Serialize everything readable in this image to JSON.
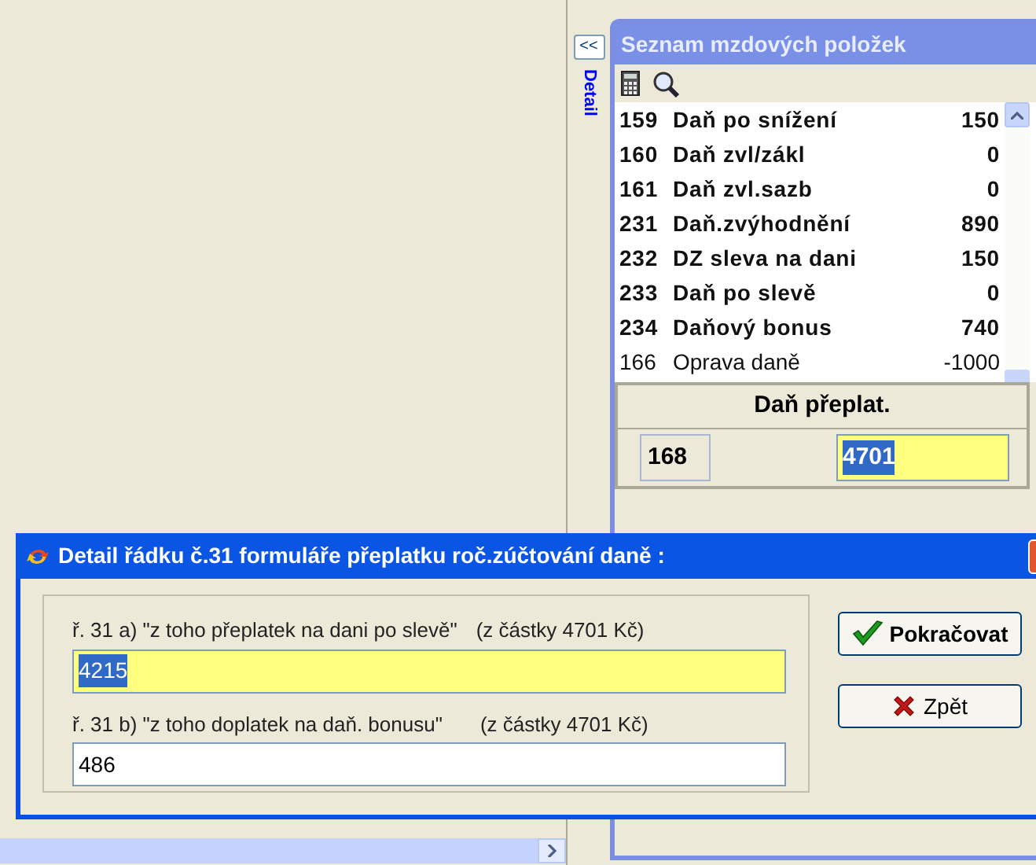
{
  "side_strip": {
    "collapse_button": "<<",
    "tab_label": "Detail"
  },
  "panel": {
    "title": "Seznam mzdových položek",
    "items": [
      {
        "code": "159",
        "name": "Daň po snížení",
        "value": "150",
        "emphasized": true
      },
      {
        "code": "160",
        "name": "Daň zvl/zákl",
        "value": "0",
        "emphasized": true
      },
      {
        "code": "161",
        "name": "Daň zvl.sazb",
        "value": "0",
        "emphasized": true
      },
      {
        "code": "231",
        "name": "Daň.zvýhodnění",
        "value": "890",
        "emphasized": true
      },
      {
        "code": "232",
        "name": "DZ sleva na dani",
        "value": "150",
        "emphasized": true
      },
      {
        "code": "233",
        "name": "Daň po slevě",
        "value": "0",
        "emphasized": true
      },
      {
        "code": "234",
        "name": "Daňový bonus",
        "value": "740",
        "emphasized": true
      },
      {
        "code": "166",
        "name": "Oprava daně",
        "value": "-1000",
        "emphasized": false
      }
    ],
    "detail": {
      "heading": "Daň přeplat.",
      "code": "168",
      "value": "4701",
      "focused": true
    }
  },
  "dialog": {
    "title": "Detail řádku č.31 formuláře přeplatku roč.zúčtování daně :",
    "fields": [
      {
        "label": "ř. 31 a) \"z toho přeplatek na dani po slevě\"",
        "note": "(z částky 4701 Kč)",
        "value": "4215",
        "focused": true
      },
      {
        "label": "ř. 31 b) \"z toho doplatek na daň. bonusu\"",
        "note": "(z částky 4701 Kč)",
        "value": "486",
        "focused": false
      }
    ],
    "buttons": [
      {
        "kind": "confirm",
        "label": "Pokračovat"
      },
      {
        "kind": "cancel",
        "label": "Zpět"
      }
    ]
  }
}
